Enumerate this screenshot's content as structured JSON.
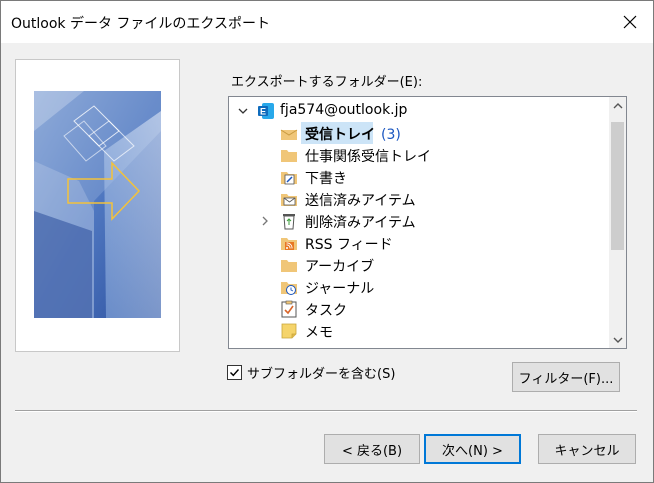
{
  "dialog": {
    "title": "Outlook データ ファイルのエクスポート"
  },
  "export_folder_label": "エクスポートするフォルダー(E):",
  "tree": {
    "items": [
      {
        "label": "fja574@outlook.jp",
        "icon": "exchange-account-icon",
        "expanded": true
      },
      {
        "label": "受信トレイ",
        "count": "(3)",
        "icon": "inbox-icon",
        "selected": true
      },
      {
        "label": "仕事関係受信トレイ",
        "icon": "folder-icon"
      },
      {
        "label": "下書き",
        "icon": "drafts-icon"
      },
      {
        "label": "送信済みアイテム",
        "icon": "sent-items-icon"
      },
      {
        "label": "削除済みアイテム",
        "icon": "deleted-items-icon",
        "collapsed": true
      },
      {
        "label": "RSS フィード",
        "icon": "rss-feed-icon"
      },
      {
        "label": "アーカイブ",
        "icon": "archive-icon"
      },
      {
        "label": "ジャーナル",
        "icon": "journal-icon"
      },
      {
        "label": "タスク",
        "icon": "tasks-icon"
      },
      {
        "label": "メモ",
        "icon": "notes-icon"
      }
    ]
  },
  "include_subfolders": {
    "label": "サブフォルダーを含む(S)",
    "checked": true
  },
  "buttons": {
    "filter": "フィルター(F)...",
    "back": "< 戻る(B)",
    "next": "次へ(N) >",
    "cancel": "キャンセル"
  },
  "colors": {
    "accent": "#0078d7",
    "selection": "#cce4f7",
    "folder": "#f0c678",
    "count_text": "#1a56c0",
    "exchange": "#0f6cbd"
  }
}
